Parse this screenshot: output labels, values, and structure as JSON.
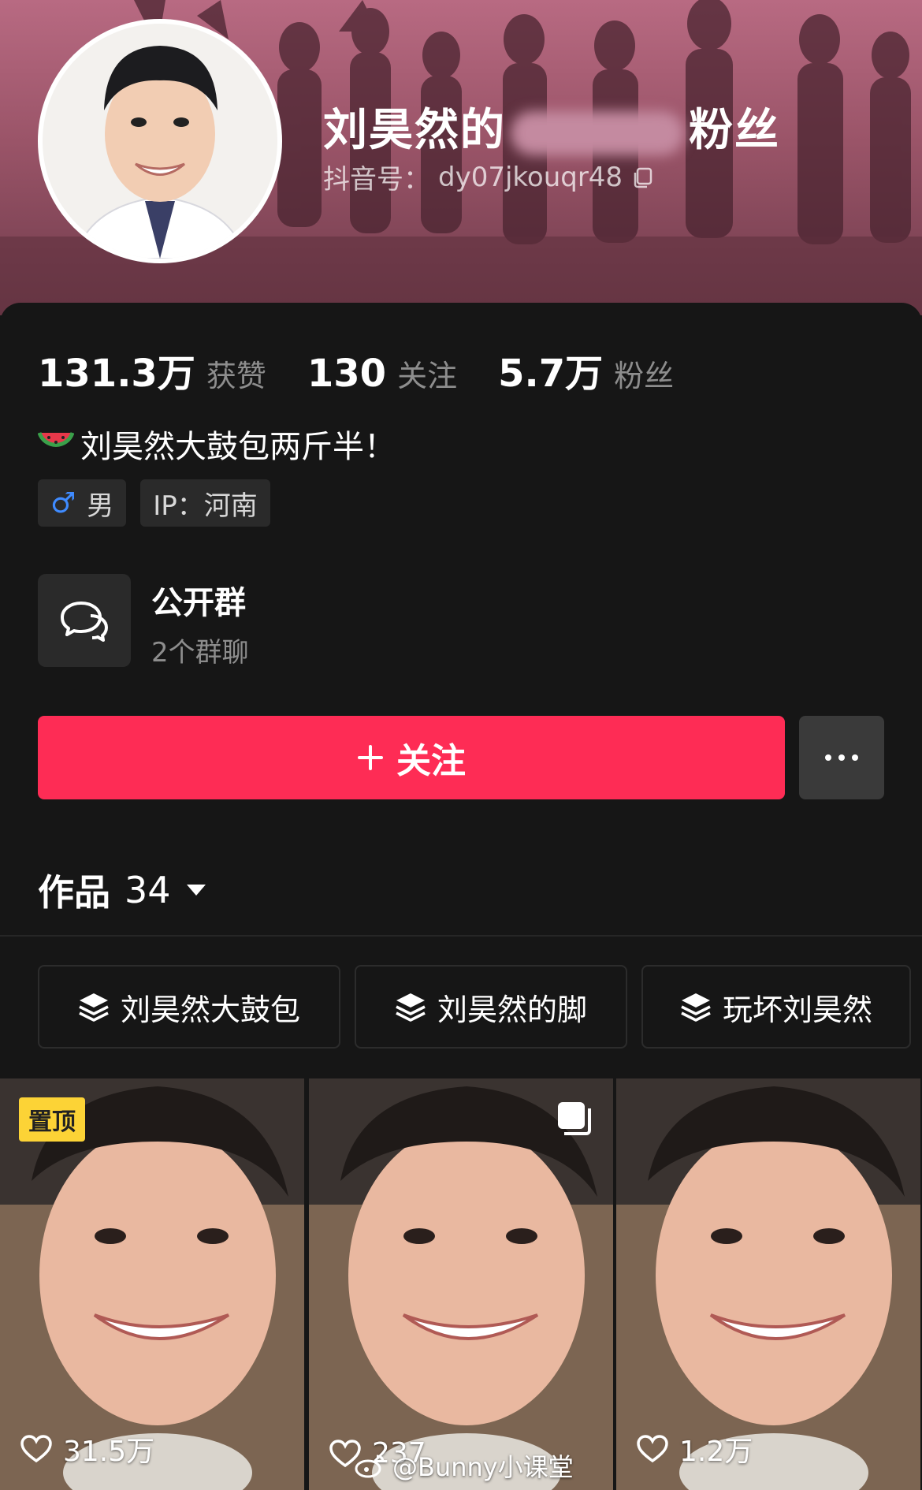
{
  "profile": {
    "name_prefix": "刘昊然的",
    "name_suffix": "粉丝",
    "douyin_id_label": "抖音号：",
    "douyin_id": "dy07jkouqr48"
  },
  "stats": [
    {
      "value": "131.3万",
      "label": "获赞"
    },
    {
      "value": "130",
      "label": "关注"
    },
    {
      "value": "5.7万",
      "label": "粉丝"
    }
  ],
  "bio": "刘昊然大鼓包两斤半！",
  "bio_icon": "watermelon-icon",
  "tags": {
    "gender": "男",
    "ip": "IP：河南"
  },
  "group": {
    "title": "公开群",
    "subtitle": "2个群聊"
  },
  "actions": {
    "follow_label": "关注",
    "more_icon": "more-dots-icon"
  },
  "works": {
    "label": "作品",
    "count": "34"
  },
  "collections": [
    {
      "label": "刘昊然大鼓包"
    },
    {
      "label": "刘昊然的脚"
    },
    {
      "label": "玩坏刘昊然"
    }
  ],
  "videos": [
    {
      "pinned": "置顶",
      "likes": "31.5万"
    },
    {
      "likes": "237"
    },
    {
      "likes": "1.2万"
    }
  ],
  "watermark": "@Bunny小课堂",
  "colors": {
    "accent": "#fe2c55",
    "pinned_badge": "#fcd336",
    "male_icon": "#3f8bff",
    "background": "#161616"
  }
}
